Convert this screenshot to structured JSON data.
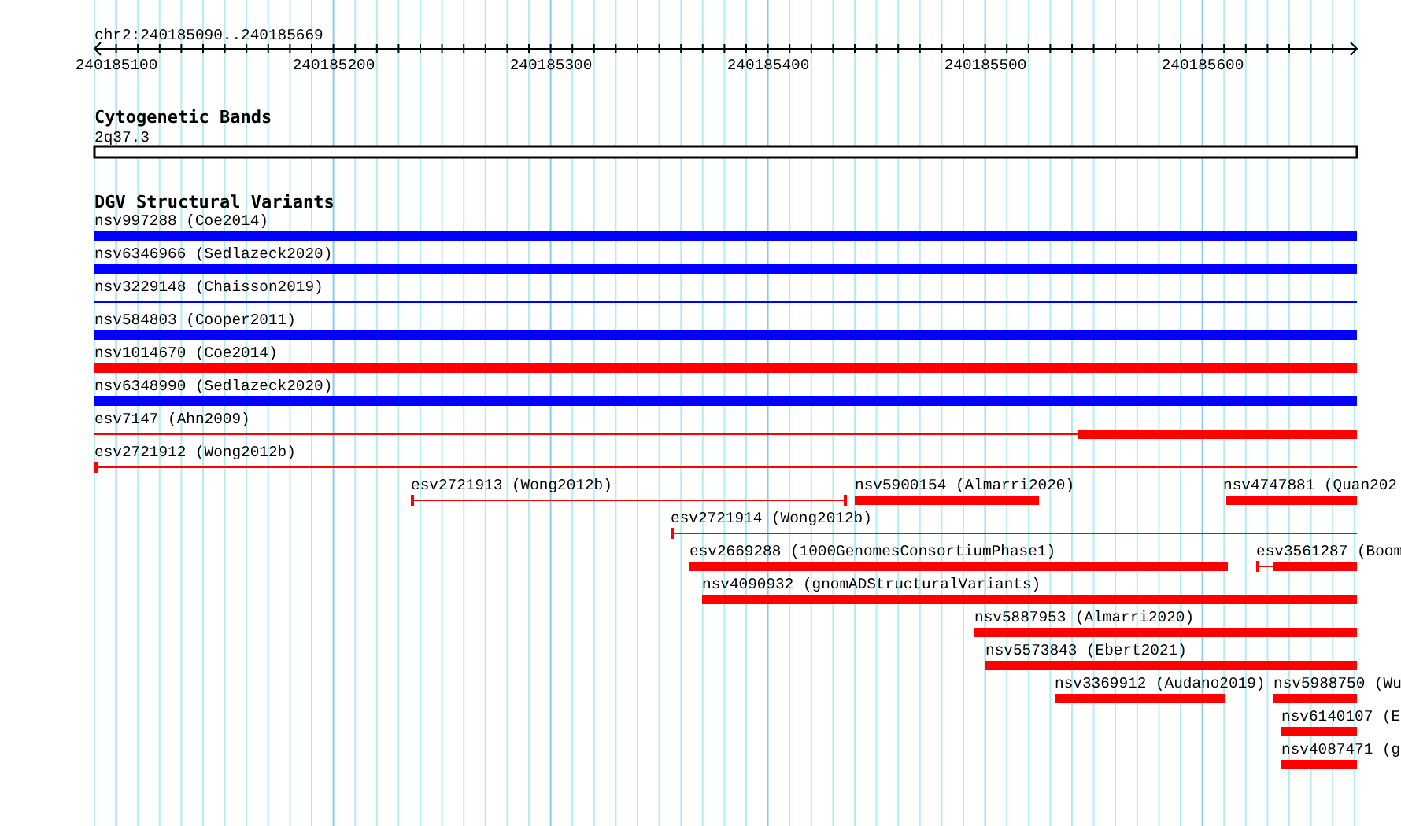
{
  "location": "chr2:240185090..240185669",
  "ruler": {
    "ticks": [
      "240185100",
      "240185200",
      "240185300",
      "240185400",
      "240185500",
      "240185600"
    ]
  },
  "tracks": [
    {
      "title": "Cytogenetic Bands",
      "features": [
        {
          "label": "2q37.3",
          "kind": "band"
        }
      ]
    },
    {
      "title": "DGV Structural Variants",
      "features": [
        {
          "label": "nsv997288 (Coe2014)",
          "kind": "bar",
          "color": "#0000ff"
        },
        {
          "label": "nsv6346966 (Sedlazeck2020)",
          "kind": "bar",
          "color": "#0000ff"
        },
        {
          "label": "nsv3229148 (Chaisson2019)",
          "kind": "line",
          "color": "#0000ff"
        },
        {
          "label": "nsv584803 (Cooper2011)",
          "kind": "bar",
          "color": "#0000ff"
        },
        {
          "label": "nsv1014670 (Coe2014)",
          "kind": "bar",
          "color": "#ff0000"
        },
        {
          "label": "nsv6348990 (Sedlazeck2020)",
          "kind": "bar",
          "color": "#0000ff"
        },
        {
          "label": "esv7147 (Ahn2009)",
          "kind": "line",
          "color": "#ff0000"
        },
        {
          "label": "esv2721912 (Wong2012b)",
          "kind": "line",
          "color": "#ff0000"
        },
        {
          "label": "esv2721913 (Wong2012b)",
          "kind": "line",
          "color": "#ff0000"
        },
        {
          "label": "nsv5900154 (Almarri2020)",
          "kind": "bar",
          "color": "#ff0000"
        },
        {
          "label": "nsv4747881 (Quan202",
          "kind": "bar",
          "color": "#ff0000"
        },
        {
          "label": "esv2721914 (Wong2012b)",
          "kind": "line",
          "color": "#ff0000"
        },
        {
          "label": "esv2669288 (1000GenomesConsortiumPhase1)",
          "kind": "bar",
          "color": "#ff0000"
        },
        {
          "label": "esv3561287 (Boom",
          "kind": "line",
          "color": "#ff0000"
        },
        {
          "label": "nsv4090932 (gnomADStructuralVariants)",
          "kind": "bar",
          "color": "#ff0000"
        },
        {
          "label": "nsv5887953 (Almarri2020)",
          "kind": "bar",
          "color": "#ff0000"
        },
        {
          "label": "nsv5573843 (Ebert2021)",
          "kind": "bar",
          "color": "#ff0000"
        },
        {
          "label": "nsv3369912 (Audano2019)",
          "kind": "bar",
          "color": "#ff0000"
        },
        {
          "label": "nsv5988750 (Wu",
          "kind": "bar",
          "color": "#ff0000"
        },
        {
          "label": "nsv6140107 (E",
          "kind": "bar",
          "color": "#ff0000"
        },
        {
          "label": "nsv4087471 (g",
          "kind": "bar",
          "color": "#ff0000"
        }
      ]
    }
  ]
}
